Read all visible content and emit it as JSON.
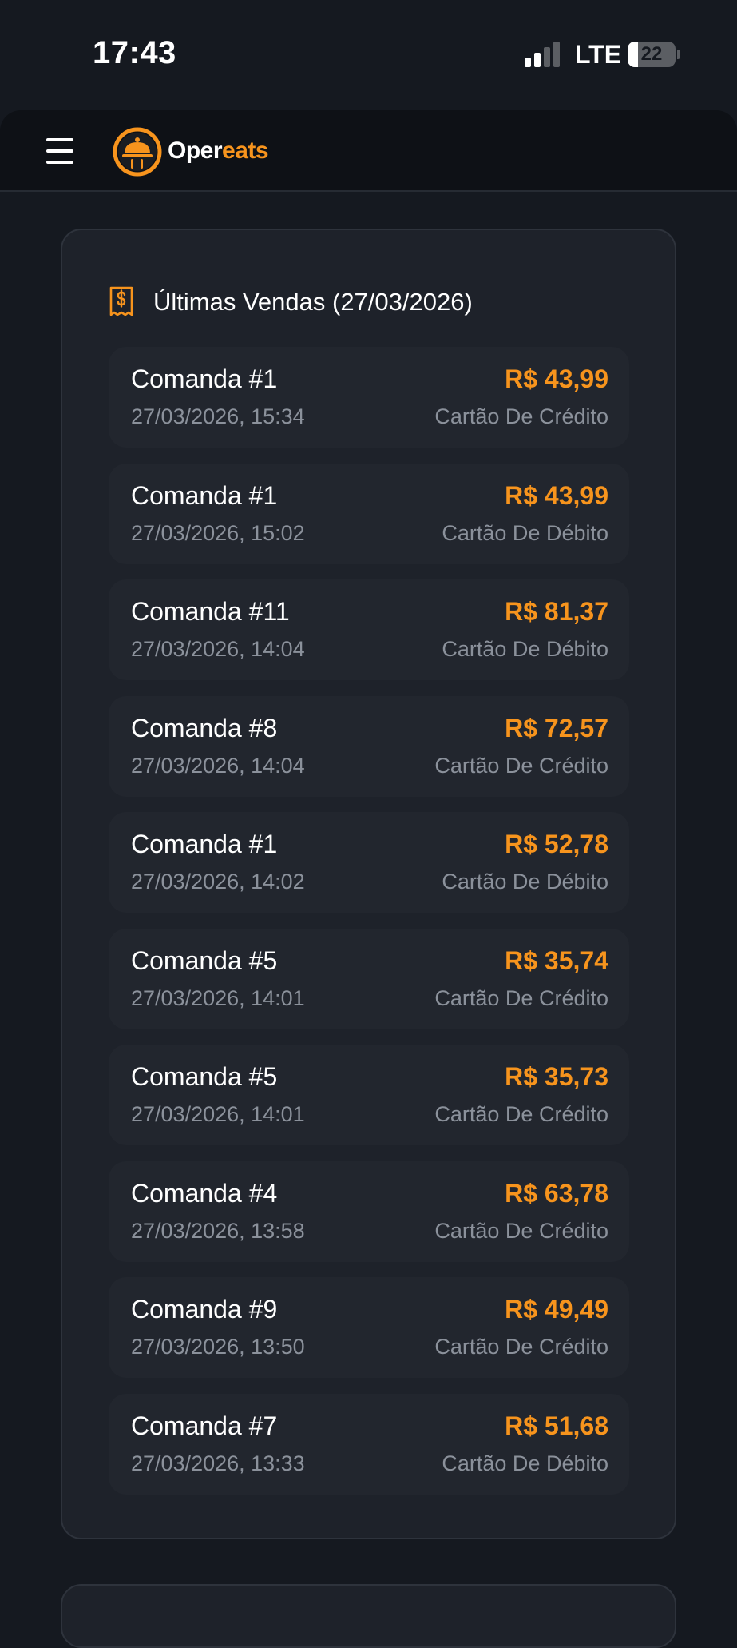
{
  "status_bar": {
    "time": "17:43",
    "network": "LTE",
    "battery_level": "22",
    "signal_bars": 2,
    "signal_bars_total": 4
  },
  "header": {
    "brand_part1": "Oper",
    "brand_part2": "eats",
    "brand_color": "#f7941d"
  },
  "sales": {
    "title": "Últimas Vendas (27/03/2026)",
    "icon": "receipt-dollar-icon",
    "items": [
      {
        "name": "Comanda #1",
        "date": "27/03/2026, 15:34",
        "amount": "R$ 43,99",
        "method": "Cartão De Crédito"
      },
      {
        "name": "Comanda #1",
        "date": "27/03/2026, 15:02",
        "amount": "R$ 43,99",
        "method": "Cartão De Débito"
      },
      {
        "name": "Comanda #11",
        "date": "27/03/2026, 14:04",
        "amount": "R$ 81,37",
        "method": "Cartão De Débito"
      },
      {
        "name": "Comanda #8",
        "date": "27/03/2026, 14:04",
        "amount": "R$ 72,57",
        "method": "Cartão De Crédito"
      },
      {
        "name": "Comanda #1",
        "date": "27/03/2026, 14:02",
        "amount": "R$ 52,78",
        "method": "Cartão De Débito"
      },
      {
        "name": "Comanda #5",
        "date": "27/03/2026, 14:01",
        "amount": "R$ 35,74",
        "method": "Cartão De Crédito"
      },
      {
        "name": "Comanda #5",
        "date": "27/03/2026, 14:01",
        "amount": "R$ 35,73",
        "method": "Cartão De Crédito"
      },
      {
        "name": "Comanda #4",
        "date": "27/03/2026, 13:58",
        "amount": "R$ 63,78",
        "method": "Cartão De Crédito"
      },
      {
        "name": "Comanda #9",
        "date": "27/03/2026, 13:50",
        "amount": "R$ 49,49",
        "method": "Cartão De Crédito"
      },
      {
        "name": "Comanda #7",
        "date": "27/03/2026, 13:33",
        "amount": "R$ 51,68",
        "method": "Cartão De Débito"
      }
    ]
  },
  "colors": {
    "background": "#151920",
    "card": "#1e222a",
    "accent": "#f7941d",
    "muted_text": "#8b919b"
  }
}
